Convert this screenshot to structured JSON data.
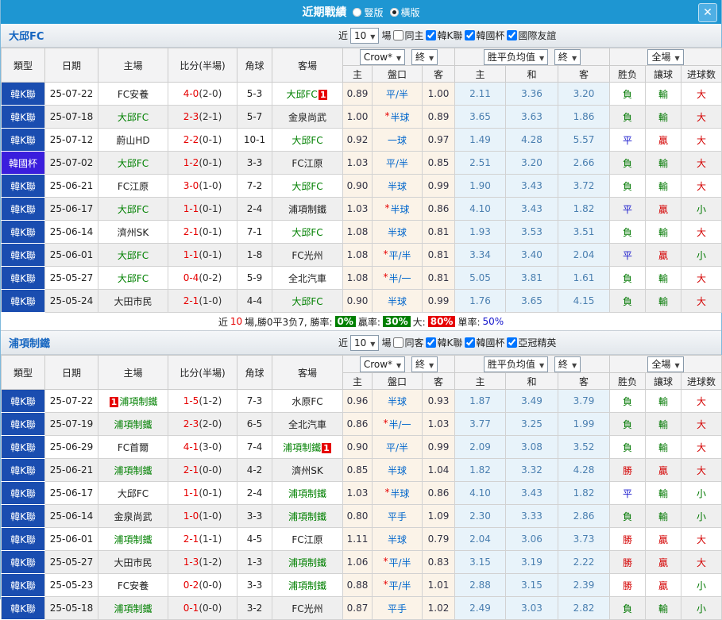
{
  "titlebar": {
    "title": "近期戰績",
    "radio_vertical": "豎版",
    "radio_horizontal": "橫版",
    "selected_layout": "橫版",
    "close_glyph": "✕"
  },
  "colors": {
    "accent_blue": "#1E96D2",
    "league_cell_bg": "#1A4DB0",
    "cup_cell_bg": "#3A1EDD",
    "focus_team_green": "#008000",
    "score_red": "#E60000",
    "handicap_blue": "#0066CC",
    "avg_odds_blue": "#4A7FB0",
    "win_red": "#D40000",
    "draw_blue": "#1414CC",
    "loss_green": "#007800",
    "rate_badge_green": "#008000",
    "rate_badge_red": "#E60000"
  },
  "badge_text": "1",
  "controls": {
    "crow": "Crow*",
    "final": "終",
    "avg": "胜平负均值",
    "full": "全場"
  },
  "columns": {
    "type": "類型",
    "date": "日期",
    "home": "主場",
    "score": "比分(半場)",
    "corner": "角球",
    "away": "客場",
    "odds_home": "主",
    "handicap": "盤口",
    "odds_away": "客",
    "avg_home": "主",
    "avg_draw": "和",
    "avg_away": "客",
    "result": "胜负",
    "handicap_result": "讓球",
    "goals": "进球数"
  },
  "summary": {
    "t_near": "近",
    "games": "10",
    "t_record": "場,勝0平3负7, 勝率:",
    "win_rate": "0%",
    "t_hcp": "贏率:",
    "hcp_rate": "30%",
    "t_big": "大:",
    "big_rate": "80%",
    "t_single": "單率:",
    "single_rate": "50%"
  },
  "tables": [
    {
      "team": "大邱FC",
      "filters": {
        "near_label": "近",
        "count": "10",
        "games_label": "場",
        "options": [
          {
            "label": "同主",
            "checked": false
          },
          {
            "label": "韓K聯",
            "checked": true
          },
          {
            "label": "韓國杯",
            "checked": true
          },
          {
            "label": "國際友誼",
            "checked": true
          }
        ]
      },
      "rows": [
        {
          "league": "韓K聯",
          "date": "25-07-22",
          "home": "FC安養",
          "away": "大邱FC",
          "away_focus": true,
          "away_badge": "after",
          "score": "4-0",
          "half": "(2-0)",
          "corners": "5-3",
          "odds_home": "0.89",
          "handicap": "平/半",
          "odds_away": "1.00",
          "avg_home": "2.11",
          "avg_draw": "3.36",
          "avg_away": "3.20",
          "result": "負",
          "handicap_result": "輸",
          "goal_result": "大"
        },
        {
          "league": "韓K聯",
          "date": "25-07-18",
          "home": "大邱FC",
          "home_focus": true,
          "away": "金泉尚武",
          "score": "2-3",
          "half": "(2-1)",
          "corners": "5-7",
          "odds_home": "1.00",
          "star": true,
          "handicap": "半球",
          "odds_away": "0.89",
          "avg_home": "3.65",
          "avg_draw": "3.63",
          "avg_away": "1.86",
          "result": "負",
          "handicap_result": "輸",
          "goal_result": "大"
        },
        {
          "league": "韓K聯",
          "date": "25-07-12",
          "home": "蔚山HD",
          "away": "大邱FC",
          "away_focus": true,
          "score": "2-2",
          "half": "(0-1)",
          "corners": "10-1",
          "odds_home": "0.92",
          "handicap": "一球",
          "odds_away": "0.97",
          "avg_home": "1.49",
          "avg_draw": "4.28",
          "avg_away": "5.57",
          "result": "平",
          "handicap_result": "贏",
          "goal_result": "大"
        },
        {
          "league": "韓國杯",
          "cup": true,
          "date": "25-07-02",
          "home": "大邱FC",
          "home_focus": true,
          "away": "FC江原",
          "score": "1-2",
          "half": "(0-1)",
          "corners": "3-3",
          "odds_home": "1.03",
          "handicap": "平/半",
          "odds_away": "0.85",
          "avg_home": "2.51",
          "avg_draw": "3.20",
          "avg_away": "2.66",
          "result": "負",
          "handicap_result": "輸",
          "goal_result": "大"
        },
        {
          "league": "韓K聯",
          "date": "25-06-21",
          "home": "FC江原",
          "away": "大邱FC",
          "away_focus": true,
          "score": "3-0",
          "half": "(1-0)",
          "corners": "7-2",
          "odds_home": "0.90",
          "handicap": "半球",
          "odds_away": "0.99",
          "avg_home": "1.90",
          "avg_draw": "3.43",
          "avg_away": "3.72",
          "result": "負",
          "handicap_result": "輸",
          "goal_result": "大"
        },
        {
          "league": "韓K聯",
          "date": "25-06-17",
          "home": "大邱FC",
          "home_focus": true,
          "away": "浦項制鐵",
          "score": "1-1",
          "half": "(0-1)",
          "corners": "2-4",
          "odds_home": "1.03",
          "star": true,
          "handicap": "半球",
          "odds_away": "0.86",
          "avg_home": "4.10",
          "avg_draw": "3.43",
          "avg_away": "1.82",
          "result": "平",
          "handicap_result": "贏",
          "goal_result": "小"
        },
        {
          "league": "韓K聯",
          "date": "25-06-14",
          "home": "濟州SK",
          "away": "大邱FC",
          "away_focus": true,
          "score": "2-1",
          "half": "(0-1)",
          "corners": "7-1",
          "odds_home": "1.08",
          "handicap": "半球",
          "odds_away": "0.81",
          "avg_home": "1.93",
          "avg_draw": "3.53",
          "avg_away": "3.51",
          "result": "負",
          "handicap_result": "輸",
          "goal_result": "大"
        },
        {
          "league": "韓K聯",
          "date": "25-06-01",
          "home": "大邱FC",
          "home_focus": true,
          "away": "FC光州",
          "score": "1-1",
          "half": "(0-1)",
          "corners": "1-8",
          "odds_home": "1.08",
          "star": true,
          "handicap": "平/半",
          "odds_away": "0.81",
          "avg_home": "3.34",
          "avg_draw": "3.40",
          "avg_away": "2.04",
          "result": "平",
          "handicap_result": "贏",
          "goal_result": "小"
        },
        {
          "league": "韓K聯",
          "date": "25-05-27",
          "home": "大邱FC",
          "home_focus": true,
          "away": "全北汽車",
          "score": "0-4",
          "half": "(0-2)",
          "corners": "5-9",
          "odds_home": "1.08",
          "star": true,
          "handicap": "半/一",
          "odds_away": "0.81",
          "avg_home": "5.05",
          "avg_draw": "3.81",
          "avg_away": "1.61",
          "result": "負",
          "handicap_result": "輸",
          "goal_result": "大"
        },
        {
          "league": "韓K聯",
          "date": "25-05-24",
          "home": "大田市民",
          "away": "大邱FC",
          "away_focus": true,
          "score": "2-1",
          "half": "(1-0)",
          "corners": "4-4",
          "odds_home": "0.90",
          "handicap": "半球",
          "odds_away": "0.99",
          "avg_home": "1.76",
          "avg_draw": "3.65",
          "avg_away": "4.15",
          "result": "負",
          "handicap_result": "輸",
          "goal_result": "大"
        }
      ]
    },
    {
      "team": "浦項制鐵",
      "filters": {
        "near_label": "近",
        "count": "10",
        "games_label": "場",
        "options": [
          {
            "label": "同客",
            "checked": false
          },
          {
            "label": "韓K聯",
            "checked": true
          },
          {
            "label": "韓國杯",
            "checked": true
          },
          {
            "label": "亞冠精英",
            "checked": true
          }
        ]
      },
      "rows": [
        {
          "league": "韓K聯",
          "date": "25-07-22",
          "home": "浦項制鐵",
          "home_focus": true,
          "home_badge": "before",
          "away": "水原FC",
          "score": "1-5",
          "half": "(1-2)",
          "corners": "7-3",
          "odds_home": "0.96",
          "handicap": "半球",
          "odds_away": "0.93",
          "avg_home": "1.87",
          "avg_draw": "3.49",
          "avg_away": "3.79",
          "result": "負",
          "handicap_result": "輸",
          "goal_result": "大"
        },
        {
          "league": "韓K聯",
          "date": "25-07-19",
          "home": "浦項制鐵",
          "home_focus": true,
          "away": "全北汽車",
          "score": "2-3",
          "half": "(2-0)",
          "corners": "6-5",
          "odds_home": "0.86",
          "star": true,
          "handicap": "半/一",
          "odds_away": "1.03",
          "avg_home": "3.77",
          "avg_draw": "3.25",
          "avg_away": "1.99",
          "result": "負",
          "handicap_result": "輸",
          "goal_result": "大"
        },
        {
          "league": "韓K聯",
          "date": "25-06-29",
          "home": "FC首爾",
          "away": "浦項制鐵",
          "away_focus": true,
          "away_badge": "after",
          "score": "4-1",
          "half": "(3-0)",
          "corners": "7-4",
          "odds_home": "0.90",
          "handicap": "平/半",
          "odds_away": "0.99",
          "avg_home": "2.09",
          "avg_draw": "3.08",
          "avg_away": "3.52",
          "result": "負",
          "handicap_result": "輸",
          "goal_result": "大"
        },
        {
          "league": "韓K聯",
          "date": "25-06-21",
          "home": "浦項制鐵",
          "home_focus": true,
          "away": "濟州SK",
          "score": "2-1",
          "half": "(0-0)",
          "corners": "4-2",
          "odds_home": "0.85",
          "handicap": "半球",
          "odds_away": "1.04",
          "avg_home": "1.82",
          "avg_draw": "3.32",
          "avg_away": "4.28",
          "result": "勝",
          "handicap_result": "贏",
          "goal_result": "大"
        },
        {
          "league": "韓K聯",
          "date": "25-06-17",
          "home": "大邱FC",
          "away": "浦項制鐵",
          "away_focus": true,
          "score": "1-1",
          "half": "(0-1)",
          "corners": "2-4",
          "odds_home": "1.03",
          "star": true,
          "handicap": "半球",
          "odds_away": "0.86",
          "avg_home": "4.10",
          "avg_draw": "3.43",
          "avg_away": "1.82",
          "result": "平",
          "handicap_result": "輸",
          "goal_result": "小"
        },
        {
          "league": "韓K聯",
          "date": "25-06-14",
          "home": "金泉尚武",
          "away": "浦項制鐵",
          "away_focus": true,
          "score": "1-0",
          "half": "(1-0)",
          "corners": "3-3",
          "odds_home": "0.80",
          "handicap": "平手",
          "odds_away": "1.09",
          "avg_home": "2.30",
          "avg_draw": "3.33",
          "avg_away": "2.86",
          "result": "負",
          "handicap_result": "輸",
          "goal_result": "小"
        },
        {
          "league": "韓K聯",
          "date": "25-06-01",
          "home": "浦項制鐵",
          "home_focus": true,
          "away": "FC江原",
          "score": "2-1",
          "half": "(1-1)",
          "corners": "4-5",
          "odds_home": "1.11",
          "handicap": "半球",
          "odds_away": "0.79",
          "avg_home": "2.04",
          "avg_draw": "3.06",
          "avg_away": "3.73",
          "result": "勝",
          "handicap_result": "贏",
          "goal_result": "大"
        },
        {
          "league": "韓K聯",
          "date": "25-05-27",
          "home": "大田市民",
          "away": "浦項制鐵",
          "away_focus": true,
          "score": "1-3",
          "half": "(1-2)",
          "corners": "1-3",
          "odds_home": "1.06",
          "star": true,
          "handicap": "平/半",
          "odds_away": "0.83",
          "avg_home": "3.15",
          "avg_draw": "3.19",
          "avg_away": "2.22",
          "result": "勝",
          "handicap_result": "贏",
          "goal_result": "大"
        },
        {
          "league": "韓K聯",
          "date": "25-05-23",
          "home": "FC安養",
          "away": "浦項制鐵",
          "away_focus": true,
          "score": "0-2",
          "half": "(0-0)",
          "corners": "3-3",
          "odds_home": "0.88",
          "star": true,
          "handicap": "平/半",
          "odds_away": "1.01",
          "avg_home": "2.88",
          "avg_draw": "3.15",
          "avg_away": "2.39",
          "result": "勝",
          "handicap_result": "贏",
          "goal_result": "小"
        },
        {
          "league": "韓K聯",
          "date": "25-05-18",
          "home": "浦項制鐵",
          "home_focus": true,
          "away": "FC光州",
          "score": "0-1",
          "half": "(0-0)",
          "corners": "3-2",
          "odds_home": "0.87",
          "handicap": "平手",
          "odds_away": "1.02",
          "avg_home": "2.49",
          "avg_draw": "3.03",
          "avg_away": "2.82",
          "result": "負",
          "handicap_result": "輸",
          "goal_result": "小"
        }
      ]
    }
  ]
}
